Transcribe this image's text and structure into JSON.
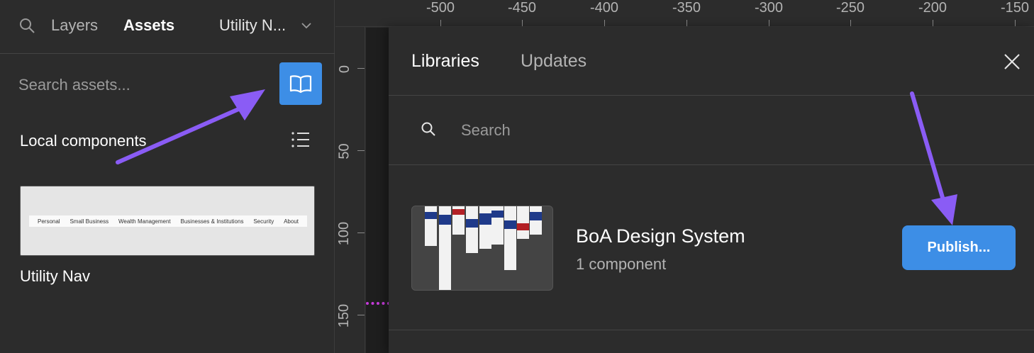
{
  "left_panel": {
    "tabs": {
      "layers": "Layers",
      "assets": "Assets"
    },
    "page_select": "Utility N...",
    "search": {
      "placeholder": "Search assets..."
    },
    "section_title": "Local components",
    "component": {
      "name": "Utility Nav",
      "preview_items": [
        "Personal",
        "Small Business",
        "Wealth Management",
        "Businesses & Institutions",
        "Security",
        "About"
      ]
    }
  },
  "rulers": {
    "x_labels": [
      "-500",
      "-450",
      "-400",
      "-350",
      "-300",
      "-250",
      "-200",
      "-150"
    ],
    "y_labels": [
      "0",
      "50",
      "100",
      "150"
    ]
  },
  "libraries_modal": {
    "tabs": {
      "libraries": "Libraries",
      "updates": "Updates"
    },
    "search": {
      "placeholder": "Search"
    },
    "library": {
      "name": "BoA Design System",
      "count": "1 component",
      "publish_label": "Publish..."
    }
  },
  "colors": {
    "accent": "#3d8ee6",
    "annotation_arrow": "#8a5cf5",
    "selection": "#c43bd9"
  }
}
